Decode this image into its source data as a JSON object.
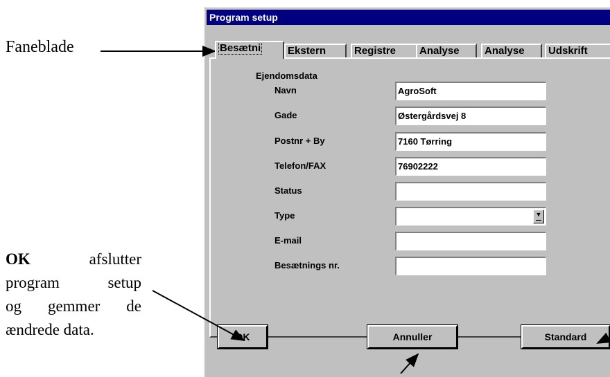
{
  "annotations": {
    "faneblade": "Faneblade",
    "ok_bold": "OK",
    "ok_line1_rest": "afslutter",
    "ok_line2": "program setup",
    "ok_line3": "og gemmer de",
    "ok_line4": "ændrede data."
  },
  "window": {
    "title": "Program setup",
    "close_glyph": "×"
  },
  "tabs": [
    {
      "label": "Besætni",
      "active": true
    },
    {
      "label": "Ekstern",
      "active": false
    },
    {
      "label": "Registre",
      "active": false
    },
    {
      "label": "Analyse",
      "active": false
    },
    {
      "label": "Analyse",
      "active": false
    },
    {
      "label": "Udskrift",
      "active": false
    }
  ],
  "form": {
    "group_label": "Ejendomsdata",
    "fields": [
      {
        "label": "Navn",
        "value": "AgroSoft"
      },
      {
        "label": "Gade",
        "value": "Østergårdsvej 8"
      },
      {
        "label": "Postnr + By",
        "value": "7160 Tørring"
      },
      {
        "label": "Telefon/FAX",
        "value": "76902222"
      },
      {
        "label": "Status",
        "value": ""
      },
      {
        "label": "Type",
        "value": ""
      },
      {
        "label": "E-mail",
        "value": ""
      },
      {
        "label": "Besætnings nr.",
        "value": ""
      }
    ]
  },
  "buttons": {
    "ok": "OK",
    "cancel": "Annuller",
    "default": "Standard"
  },
  "icons": {
    "dropdown": "chevron-down-icon",
    "close": "close-icon"
  },
  "colors": {
    "titlebar": "#000080",
    "face": "#c0c0c0"
  }
}
